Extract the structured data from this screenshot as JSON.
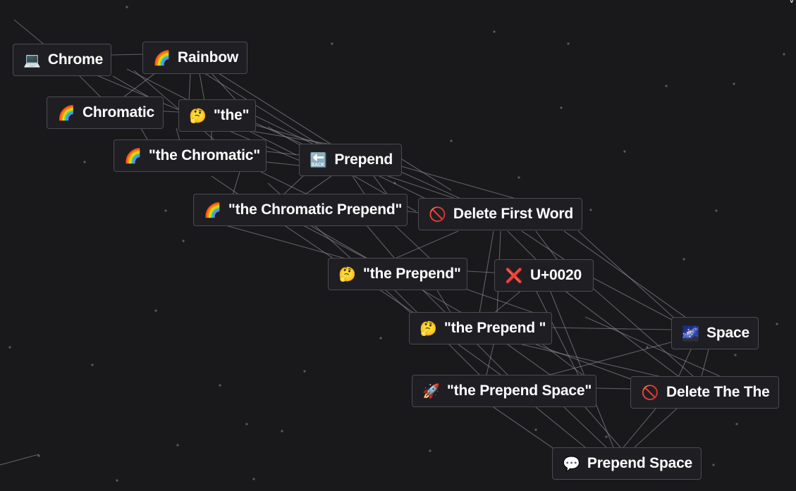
{
  "elements": [
    {
      "id": "chrome",
      "emoji": "💻",
      "label": "Chrome"
    },
    {
      "id": "rainbow",
      "emoji": "🌈",
      "label": "Rainbow"
    },
    {
      "id": "chromatic",
      "emoji": "🌈",
      "label": "Chromatic"
    },
    {
      "id": "the",
      "emoji": "🤔",
      "label": "\"the\""
    },
    {
      "id": "the-chromatic",
      "emoji": "🌈",
      "label": "\"the Chromatic\""
    },
    {
      "id": "prepend",
      "emoji": "🔙",
      "label": "Prepend"
    },
    {
      "id": "the-chromatic-prepend",
      "emoji": "🌈",
      "label": "\"the Chromatic Prepend\""
    },
    {
      "id": "delete-first-word",
      "emoji": "🚫",
      "label": "Delete First Word"
    },
    {
      "id": "the-prepend",
      "emoji": "🤔",
      "label": "\"the Prepend\""
    },
    {
      "id": "u0020",
      "emoji": "❌",
      "label": "U+0020"
    },
    {
      "id": "the-prepend-trailing",
      "emoji": "🤔",
      "label": "\"the Prepend \""
    },
    {
      "id": "space",
      "emoji": "🌌",
      "label": "Space"
    },
    {
      "id": "the-prepend-space",
      "emoji": "🚀",
      "label": "\"the Prepend Space\""
    },
    {
      "id": "delete-the-the",
      "emoji": "🚫",
      "label": "Delete The The"
    },
    {
      "id": "prepend-space",
      "emoji": "💬",
      "label": "Prepend Space"
    }
  ],
  "corner_glyph": "v",
  "colors": {
    "background": "#19191c",
    "node_bg": "#1f1f23",
    "node_border": "#4a4a52",
    "edge": "#9a9aa2",
    "star": "#5a5a62"
  }
}
